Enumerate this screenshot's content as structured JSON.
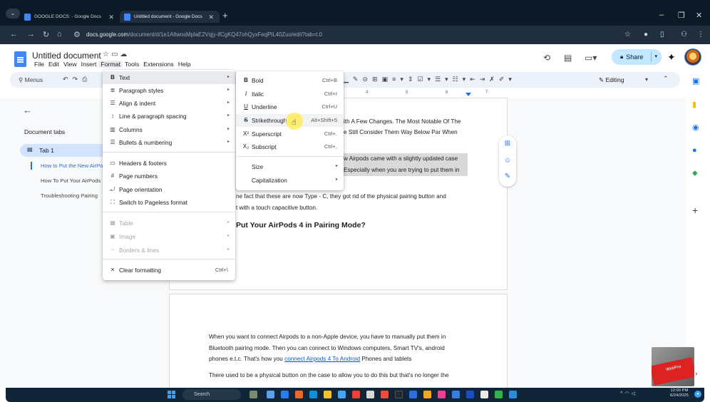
{
  "browser": {
    "tabs": [
      {
        "label": "GOOGLE DOCS: - Google Docs"
      },
      {
        "label": "Untitled document - Google Docs"
      }
    ],
    "url_host": "docs.google.com",
    "url_path": "/document/d/1e1AltwosMplaE2Vqjy-ifCgKQ47ohQyxFeqPIL40Zuo/edit?tab=t.0"
  },
  "docs": {
    "title": "Untitled document",
    "menus": [
      "File",
      "Edit",
      "View",
      "Insert",
      "Format",
      "Tools",
      "Extensions",
      "Help"
    ],
    "share_label": "Share",
    "toolbar_search": "Menus",
    "mode_label": "Editing"
  },
  "ruler": {
    "numbers": [
      "4",
      "5",
      "6",
      "7"
    ]
  },
  "doc_tabs": {
    "heading": "Document tabs",
    "tab_label": "Tab 1",
    "outline": [
      "How to Put the New AirPods",
      "How To Put Your AirPods",
      "Troubleshooting Pairing"
    ]
  },
  "format_menu": {
    "items": [
      {
        "icon": "B",
        "label": "Text"
      },
      {
        "icon": "≣",
        "label": "Paragraph styles"
      },
      {
        "icon": "☰",
        "label": "Align & indent"
      },
      {
        "icon": "↕",
        "label": "Line & paragraph spacing"
      },
      {
        "icon": "▥",
        "label": "Columns"
      },
      {
        "icon": "☰",
        "label": "Bullets & numbering"
      },
      {
        "icon": "▭",
        "label": "Headers & footers"
      },
      {
        "icon": "#",
        "label": "Page numbers"
      },
      {
        "icon": "⤾",
        "label": "Page orientation"
      },
      {
        "icon": "⛶",
        "label": "Switch to Pageless format"
      },
      {
        "icon": "▦",
        "label": "Table"
      },
      {
        "icon": "▣",
        "label": "Image"
      },
      {
        "icon": "┄",
        "label": "Borders & lines"
      },
      {
        "icon": "✕",
        "label": "Clear formatting",
        "shortcut": "Ctrl+\\"
      }
    ]
  },
  "text_submenu": {
    "items": [
      {
        "icon": "B",
        "label": "Bold",
        "shortcut": "Ctrl+B"
      },
      {
        "icon": "I",
        "label": "Italic",
        "shortcut": "Ctrl+I"
      },
      {
        "icon": "U",
        "label": "Underline",
        "shortcut": "Ctrl+U"
      },
      {
        "icon": "S",
        "label": "Strikethrough",
        "shortcut": "Alt+Shift+5"
      },
      {
        "icon": "X²",
        "label": "Superscript",
        "shortcut": "Ctrl+."
      },
      {
        "icon": "X₂",
        "label": "Subscript",
        "shortcut": "Ctrl+,"
      },
      {
        "label": "Size"
      },
      {
        "label": "Capitalization"
      }
    ]
  },
  "document": {
    "p1_line1": "ith A Few Changes. The Most Notable Of The",
    "p1_line2": "e Still Consider Them Way Below Par When",
    "p2_line1": "w Airpods came with a slightly updated case",
    "p2_line2": "Especially when you are trying to put them in",
    "p3_line1": "ne fact that these are now Type - C, they got rid of the physical pairing button and",
    "p3_line2": "t with a touch capacitive button.",
    "heading": "Put Your AirPods 4 in Pairing Mode?",
    "page2_line1": "When you want to connect Airpods to a non-Apple device, you have to manually put them in",
    "page2_line2": "Bluetooth pairing mode. Then you can connect to Windows computers, Smart TV's, android",
    "page2_line3_a": "phones e.t.c. That's how you ",
    "page2_line3_link": "connect Airpods 4 To Android",
    "page2_line3_b": " Phones and tablets",
    "page2_line4": "There used to be a physical button on the case to allow you to do this but that's no longer the"
  },
  "taskbar": {
    "search_label": "Search",
    "time": "12:00 PM",
    "date": "6/24/2025"
  },
  "thumbnail": {
    "text": "WebPro"
  },
  "colors": {
    "accent": "#1a73e8",
    "share_bg": "#c2e7ff",
    "chrome_dark": "#0b1a26"
  }
}
